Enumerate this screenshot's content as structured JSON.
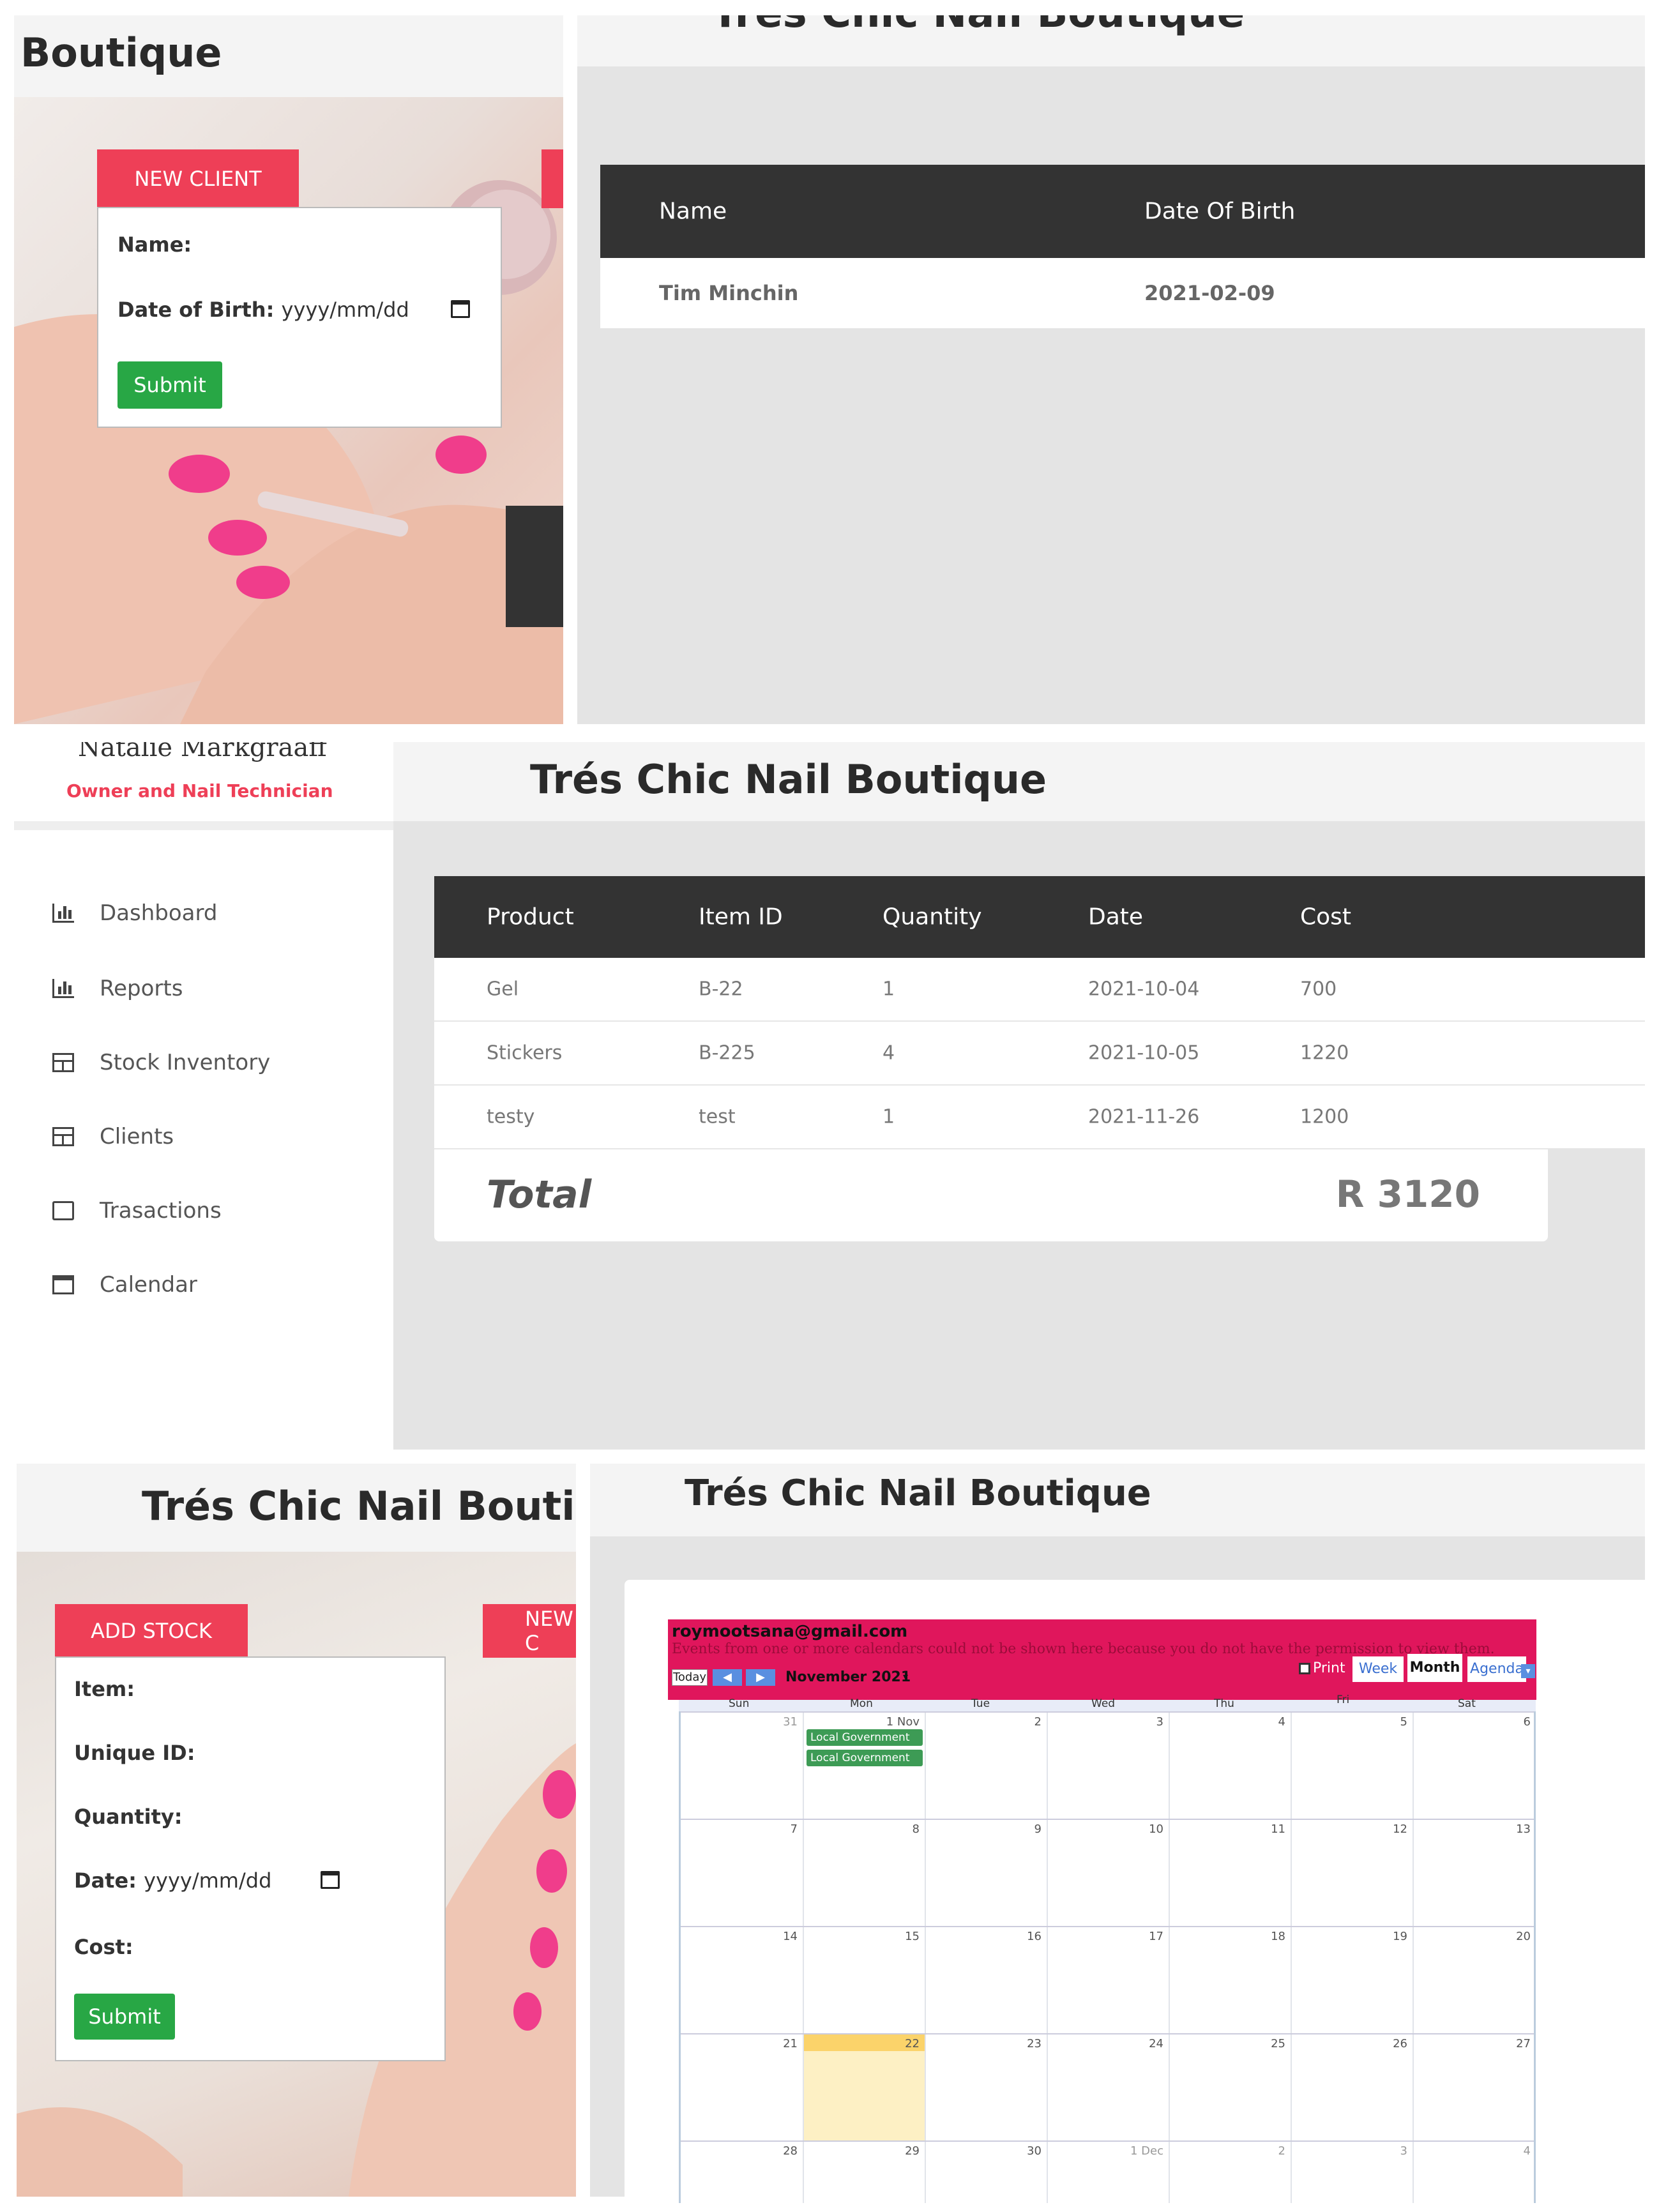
{
  "colors": {
    "accent": "#ee3f57",
    "submit": "#28a745",
    "table_header": "#333333",
    "calendar_bar": "#e0165c",
    "today": "#fde9a6"
  },
  "panel1": {
    "title": "Boutique",
    "new_client_tab": "NEW CLIENT",
    "form": {
      "name_label": "Name:",
      "dob_label": "Date of Birth:",
      "dob_placeholder": "yyyy/mm/dd",
      "submit": "Submit"
    },
    "icons": [
      "calendar-icon"
    ]
  },
  "panel2": {
    "title": "Trés Chic Nail Boutique",
    "table": {
      "headers": [
        "Name",
        "Date Of Birth"
      ],
      "rows": [
        [
          "Tim Minchin",
          "2021-02-09"
        ]
      ]
    }
  },
  "panel3": {
    "owner_name": "Natalie Markgraaff",
    "owner_role": "Owner and Nail Technician",
    "title": "Trés Chic Nail Boutique",
    "sidebar": [
      {
        "label": "Dashboard",
        "icon": "bar-chart-icon"
      },
      {
        "label": "Reports",
        "icon": "bar-chart-icon"
      },
      {
        "label": "Stock Inventory",
        "icon": "table-icon"
      },
      {
        "label": "Clients",
        "icon": "table-icon"
      },
      {
        "label": "Trasactions",
        "icon": "checkbox-icon"
      },
      {
        "label": "Calendar",
        "icon": "calendar-icon"
      }
    ],
    "table": {
      "headers": [
        "Product",
        "Item ID",
        "Quantity",
        "Date",
        "Cost"
      ],
      "rows": [
        [
          "Gel",
          "B-22",
          "1",
          "2021-10-04",
          "700"
        ],
        [
          "Stickers",
          "B-225",
          "4",
          "2021-10-05",
          "1220"
        ],
        [
          "testy",
          "test",
          "1",
          "2021-11-26",
          "1200"
        ]
      ]
    },
    "total_label": "Total",
    "total_value": "R 3120"
  },
  "panel4": {
    "title": "Trés Chic Nail Boutique",
    "add_stock_tab": "ADD STOCK",
    "new_tab": "NEW C",
    "form": {
      "item_label": "Item:",
      "uid_label": "Unique ID:",
      "qty_label": "Quantity:",
      "date_label": "Date:",
      "date_placeholder": "yyyy/mm/dd",
      "cost_label": "Cost:",
      "submit": "Submit"
    }
  },
  "panel5": {
    "title": "Trés Chic Nail Boutique",
    "calendar": {
      "account": "roymootsana@gmail.com",
      "warning": "Events from one or more calendars could not be shown here because you do not have the permission to view them.",
      "today_btn": "Today",
      "month": "November 2021",
      "print": "Print",
      "views": [
        "Week",
        "Month",
        "Agenda"
      ],
      "active_view": "Month",
      "weekdays": [
        "Sun",
        "Mon",
        "Tue",
        "Wed",
        "Thu",
        "Fri",
        "Sat"
      ],
      "weeks": [
        [
          "31",
          "1 Nov",
          "2",
          "3",
          "4",
          "5",
          "6"
        ],
        [
          "7",
          "8",
          "9",
          "10",
          "11",
          "12",
          "13"
        ],
        [
          "14",
          "15",
          "16",
          "17",
          "18",
          "19",
          "20"
        ],
        [
          "21",
          "22",
          "23",
          "24",
          "25",
          "26",
          "27"
        ],
        [
          "28",
          "29",
          "30",
          "1 Dec",
          "2",
          "3",
          "4"
        ]
      ],
      "events": [
        "Local Government",
        "Local Government"
      ]
    }
  }
}
